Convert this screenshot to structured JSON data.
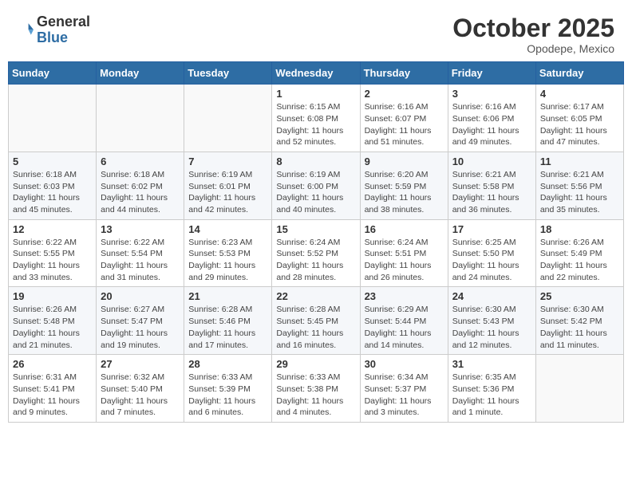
{
  "header": {
    "logo_general": "General",
    "logo_blue": "Blue",
    "month": "October 2025",
    "location": "Opodepe, Mexico"
  },
  "days_of_week": [
    "Sunday",
    "Monday",
    "Tuesday",
    "Wednesday",
    "Thursday",
    "Friday",
    "Saturday"
  ],
  "weeks": [
    [
      {
        "day": "",
        "info": ""
      },
      {
        "day": "",
        "info": ""
      },
      {
        "day": "",
        "info": ""
      },
      {
        "day": "1",
        "info": "Sunrise: 6:15 AM\nSunset: 6:08 PM\nDaylight: 11 hours\nand 52 minutes."
      },
      {
        "day": "2",
        "info": "Sunrise: 6:16 AM\nSunset: 6:07 PM\nDaylight: 11 hours\nand 51 minutes."
      },
      {
        "day": "3",
        "info": "Sunrise: 6:16 AM\nSunset: 6:06 PM\nDaylight: 11 hours\nand 49 minutes."
      },
      {
        "day": "4",
        "info": "Sunrise: 6:17 AM\nSunset: 6:05 PM\nDaylight: 11 hours\nand 47 minutes."
      }
    ],
    [
      {
        "day": "5",
        "info": "Sunrise: 6:18 AM\nSunset: 6:03 PM\nDaylight: 11 hours\nand 45 minutes."
      },
      {
        "day": "6",
        "info": "Sunrise: 6:18 AM\nSunset: 6:02 PM\nDaylight: 11 hours\nand 44 minutes."
      },
      {
        "day": "7",
        "info": "Sunrise: 6:19 AM\nSunset: 6:01 PM\nDaylight: 11 hours\nand 42 minutes."
      },
      {
        "day": "8",
        "info": "Sunrise: 6:19 AM\nSunset: 6:00 PM\nDaylight: 11 hours\nand 40 minutes."
      },
      {
        "day": "9",
        "info": "Sunrise: 6:20 AM\nSunset: 5:59 PM\nDaylight: 11 hours\nand 38 minutes."
      },
      {
        "day": "10",
        "info": "Sunrise: 6:21 AM\nSunset: 5:58 PM\nDaylight: 11 hours\nand 36 minutes."
      },
      {
        "day": "11",
        "info": "Sunrise: 6:21 AM\nSunset: 5:56 PM\nDaylight: 11 hours\nand 35 minutes."
      }
    ],
    [
      {
        "day": "12",
        "info": "Sunrise: 6:22 AM\nSunset: 5:55 PM\nDaylight: 11 hours\nand 33 minutes."
      },
      {
        "day": "13",
        "info": "Sunrise: 6:22 AM\nSunset: 5:54 PM\nDaylight: 11 hours\nand 31 minutes."
      },
      {
        "day": "14",
        "info": "Sunrise: 6:23 AM\nSunset: 5:53 PM\nDaylight: 11 hours\nand 29 minutes."
      },
      {
        "day": "15",
        "info": "Sunrise: 6:24 AM\nSunset: 5:52 PM\nDaylight: 11 hours\nand 28 minutes."
      },
      {
        "day": "16",
        "info": "Sunrise: 6:24 AM\nSunset: 5:51 PM\nDaylight: 11 hours\nand 26 minutes."
      },
      {
        "day": "17",
        "info": "Sunrise: 6:25 AM\nSunset: 5:50 PM\nDaylight: 11 hours\nand 24 minutes."
      },
      {
        "day": "18",
        "info": "Sunrise: 6:26 AM\nSunset: 5:49 PM\nDaylight: 11 hours\nand 22 minutes."
      }
    ],
    [
      {
        "day": "19",
        "info": "Sunrise: 6:26 AM\nSunset: 5:48 PM\nDaylight: 11 hours\nand 21 minutes."
      },
      {
        "day": "20",
        "info": "Sunrise: 6:27 AM\nSunset: 5:47 PM\nDaylight: 11 hours\nand 19 minutes."
      },
      {
        "day": "21",
        "info": "Sunrise: 6:28 AM\nSunset: 5:46 PM\nDaylight: 11 hours\nand 17 minutes."
      },
      {
        "day": "22",
        "info": "Sunrise: 6:28 AM\nSunset: 5:45 PM\nDaylight: 11 hours\nand 16 minutes."
      },
      {
        "day": "23",
        "info": "Sunrise: 6:29 AM\nSunset: 5:44 PM\nDaylight: 11 hours\nand 14 minutes."
      },
      {
        "day": "24",
        "info": "Sunrise: 6:30 AM\nSunset: 5:43 PM\nDaylight: 11 hours\nand 12 minutes."
      },
      {
        "day": "25",
        "info": "Sunrise: 6:30 AM\nSunset: 5:42 PM\nDaylight: 11 hours\nand 11 minutes."
      }
    ],
    [
      {
        "day": "26",
        "info": "Sunrise: 6:31 AM\nSunset: 5:41 PM\nDaylight: 11 hours\nand 9 minutes."
      },
      {
        "day": "27",
        "info": "Sunrise: 6:32 AM\nSunset: 5:40 PM\nDaylight: 11 hours\nand 7 minutes."
      },
      {
        "day": "28",
        "info": "Sunrise: 6:33 AM\nSunset: 5:39 PM\nDaylight: 11 hours\nand 6 minutes."
      },
      {
        "day": "29",
        "info": "Sunrise: 6:33 AM\nSunset: 5:38 PM\nDaylight: 11 hours\nand 4 minutes."
      },
      {
        "day": "30",
        "info": "Sunrise: 6:34 AM\nSunset: 5:37 PM\nDaylight: 11 hours\nand 3 minutes."
      },
      {
        "day": "31",
        "info": "Sunrise: 6:35 AM\nSunset: 5:36 PM\nDaylight: 11 hours\nand 1 minute."
      },
      {
        "day": "",
        "info": ""
      }
    ]
  ]
}
